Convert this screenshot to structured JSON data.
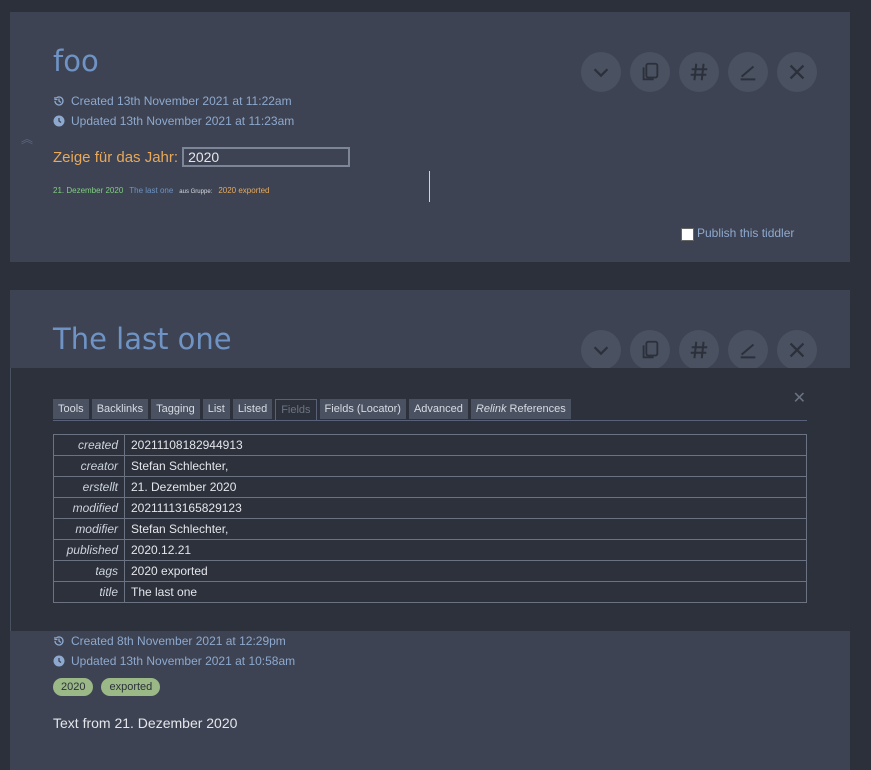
{
  "t1": {
    "title": "foo",
    "created": "Created 13th November 2021 at 11:22am",
    "updated": "Updated 13th November 2021 at 11:23am",
    "year_label": "Zeige für das Jahr:",
    "year_value": "2020",
    "list": {
      "date": "21. Dezember 2020",
      "link": "The last one",
      "gruppe": "aus Gruppe:",
      "tags": "2020 exported"
    },
    "publish_label": "Publish this tiddler"
  },
  "t2": {
    "title": "The last one",
    "tabs": [
      "Tools",
      "Backlinks",
      "Tagging",
      "List",
      "Listed",
      "Fields",
      "Fields (Locator)",
      "Advanced"
    ],
    "relink_tab": {
      "italic": "Relink",
      "rest": "References"
    },
    "active_tab": "Fields",
    "fields": [
      {
        "key": "created",
        "value": "20211108182944913"
      },
      {
        "key": "creator",
        "value": "Stefan Schlechter,"
      },
      {
        "key": "erstellt",
        "value": "21. Dezember 2020"
      },
      {
        "key": "modified",
        "value": "20211113165829123"
      },
      {
        "key": "modifier",
        "value": "Stefan Schlechter,"
      },
      {
        "key": "published",
        "value": "2020.12.21"
      },
      {
        "key": "tags",
        "value": "2020 exported"
      },
      {
        "key": "title",
        "value": "The last one"
      }
    ],
    "created": "Created 8th November 2021 at 12:29pm",
    "updated": "Updated 13th November 2021 at 10:58am",
    "tags": [
      "2020",
      "exported"
    ],
    "body": "Text from 21. Dezember 2020"
  },
  "toolbar_icons": [
    "chevron-down-icon",
    "clone-icon",
    "hash-icon",
    "edit-icon",
    "close-icon"
  ],
  "colors": {
    "accent": "#6e93c4",
    "tag_bg": "#9bb887",
    "label_orange": "#e8a95a",
    "date_green": "#7fcf7f"
  }
}
